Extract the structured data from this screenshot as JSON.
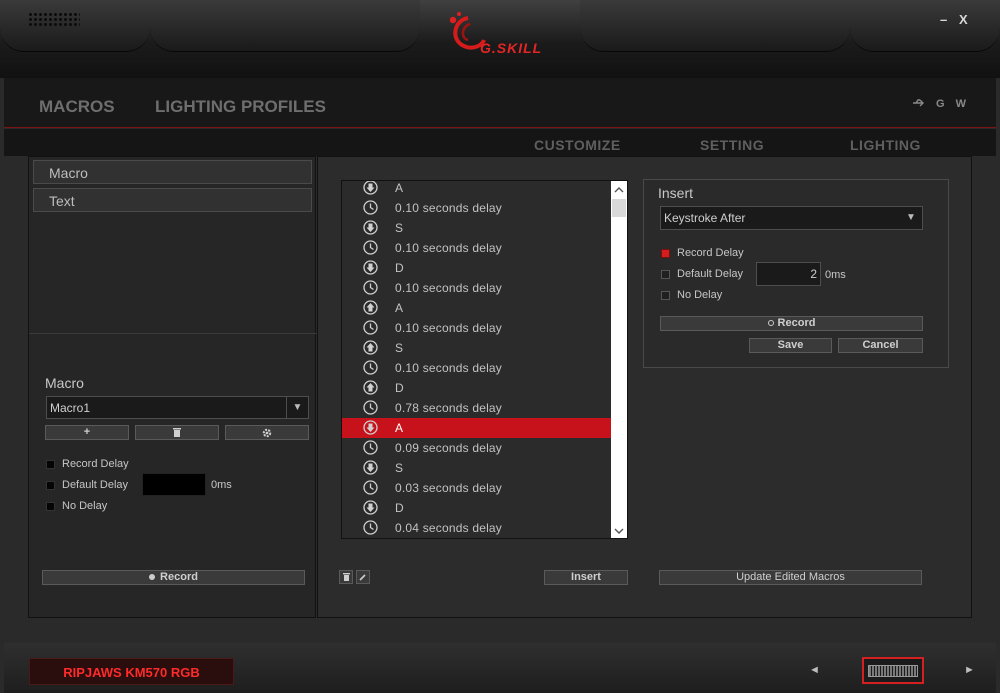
{
  "window": {
    "brand": "G.SKILL",
    "minimize": "–",
    "close": "X"
  },
  "topnav": {
    "tabs": [
      "MACROS",
      "LIGHTING PROFILES"
    ],
    "header_icons": [
      "usb-icon",
      "G",
      "W"
    ]
  },
  "subnav": {
    "tabs": [
      "CUSTOMIZE",
      "SETTING",
      "LIGHTING"
    ]
  },
  "left": {
    "categories": [
      "Macro",
      "Text"
    ],
    "macro_label": "Macro",
    "macro_select": "Macro1",
    "buttons": {
      "add": "+",
      "delete": "🗑",
      "settings": "⚙"
    },
    "options": [
      "Record Delay",
      "Default Delay",
      "No Delay"
    ],
    "delay_unit": "0ms",
    "record": "Record"
  },
  "list": {
    "rows": [
      {
        "icon": "key-down-icon",
        "text": "A"
      },
      {
        "icon": "clock-icon",
        "text": "0.10 seconds delay"
      },
      {
        "icon": "key-down-icon",
        "text": "S"
      },
      {
        "icon": "clock-icon",
        "text": "0.10 seconds delay"
      },
      {
        "icon": "key-down-icon",
        "text": "D"
      },
      {
        "icon": "clock-icon",
        "text": "0.10 seconds delay"
      },
      {
        "icon": "key-up-icon",
        "text": "A"
      },
      {
        "icon": "clock-icon",
        "text": "0.10 seconds delay"
      },
      {
        "icon": "key-up-icon",
        "text": "S"
      },
      {
        "icon": "clock-icon",
        "text": "0.10 seconds delay"
      },
      {
        "icon": "key-up-icon",
        "text": "D"
      },
      {
        "icon": "clock-icon",
        "text": "0.78 seconds delay"
      },
      {
        "icon": "key-down-icon",
        "text": "A",
        "selected": true
      },
      {
        "icon": "clock-icon",
        "text": "0.09 seconds delay"
      },
      {
        "icon": "key-down-icon",
        "text": "S"
      },
      {
        "icon": "clock-icon",
        "text": "0.03 seconds delay"
      },
      {
        "icon": "key-down-icon",
        "text": "D"
      },
      {
        "icon": "clock-icon",
        "text": "0.04 seconds delay"
      }
    ],
    "scroll_up": "^",
    "scroll_down": "v"
  },
  "insert": {
    "title": "Insert",
    "mode": "Keystroke After",
    "options": [
      "Record Delay",
      "Default Delay",
      "No Delay"
    ],
    "default_delay_value": "2",
    "delay_unit": "0ms",
    "record": "Record",
    "save": "Save",
    "cancel": "Cancel"
  },
  "bottom": {
    "insert_button": "Insert",
    "update_button": "Update Edited Macros"
  },
  "status": {
    "model": "RIPJAWS KM570 RGB",
    "prev": "◄",
    "next": "►"
  },
  "colors": {
    "accent": "#d41e1e",
    "selected_row": "#c8121b",
    "panel": "#2c2c2c"
  }
}
